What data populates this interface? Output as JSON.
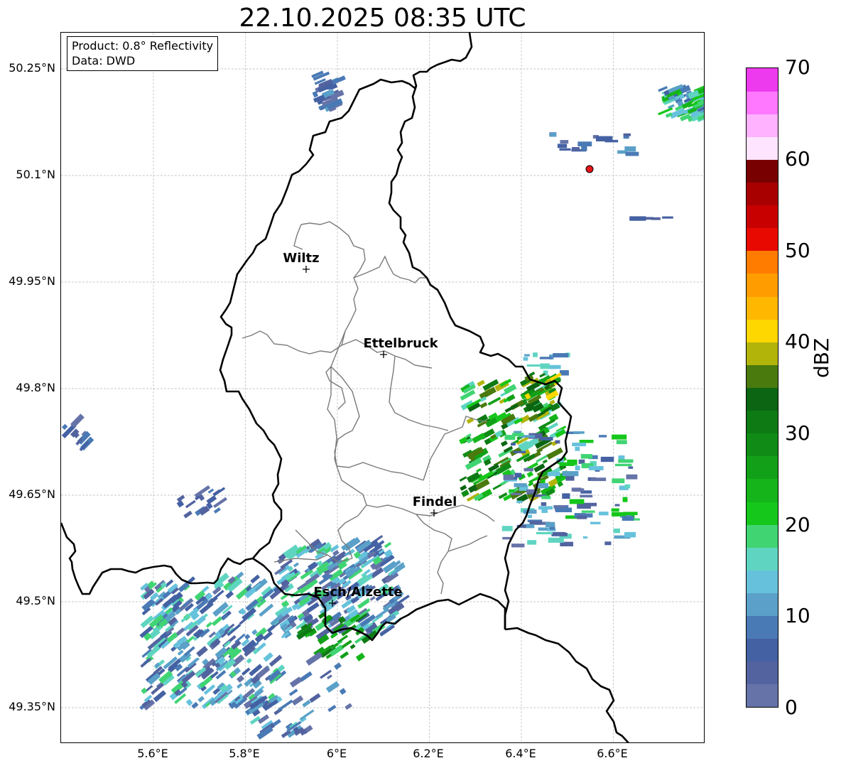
{
  "title": "22.10.2025 08:35 UTC",
  "info": {
    "product": "Product: 0.8° Reflectivity",
    "data": "Data: DWD"
  },
  "y_ticks": [
    "50.25°N",
    "50.1°N",
    "49.95°N",
    "49.8°N",
    "49.65°N",
    "49.5°N",
    "49.35°N"
  ],
  "x_ticks": [
    "5.6°E",
    "5.8°E",
    "6°E",
    "6.2°E",
    "6.4°E",
    "6.6°E"
  ],
  "cities": [
    {
      "name": "Wiltz",
      "lon": 5.93,
      "lat": 49.967
    },
    {
      "name": "Ettelbruck",
      "lon": 6.1,
      "lat": 49.847
    },
    {
      "name": "Findel",
      "lon": 6.21,
      "lat": 49.627
    },
    {
      "name": "Esch/Alzette",
      "lon": 5.99,
      "lat": 49.499
    }
  ],
  "colorbar": {
    "label": "dBZ",
    "ticks": [
      "0",
      "10",
      "20",
      "30",
      "40",
      "50",
      "60",
      "70"
    ],
    "min": 0,
    "max": 70,
    "step": 2.5,
    "colors": [
      "#6573a8",
      "#52639f",
      "#4461a3",
      "#4a7ab5",
      "#5aa0c8",
      "#66c2dc",
      "#5fd5c1",
      "#40d473",
      "#15c71a",
      "#14b41a",
      "#12a018",
      "#108c16",
      "#0e7a14",
      "#0b6512",
      "#4a7a0e",
      "#b2b40a",
      "#ffd700",
      "#ffb700",
      "#ff9c00",
      "#ff7c00",
      "#e80a00",
      "#c80000",
      "#a80000",
      "#780000",
      "#ffe4ff",
      "#ffb2ff",
      "#ff78ff",
      "#ee3aee"
    ]
  },
  "radar_site": {
    "lon": 6.548,
    "lat": 50.11,
    "color": "#e8141a"
  }
}
